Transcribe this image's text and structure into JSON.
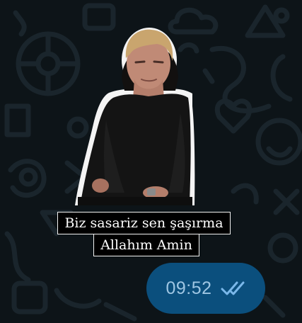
{
  "chat": {
    "background_color": "#0d1418",
    "pattern_color": "#1b252c"
  },
  "sticker": {
    "line1": "Biz sasariz sen şaşırma",
    "line2": "Allahım Amin",
    "icon": "person-photo-sticker"
  },
  "message_meta": {
    "time": "09:52",
    "status_icon": "double-check-icon",
    "bubble_color": "#0b4f7d",
    "check_color": "#7bb8ea"
  }
}
